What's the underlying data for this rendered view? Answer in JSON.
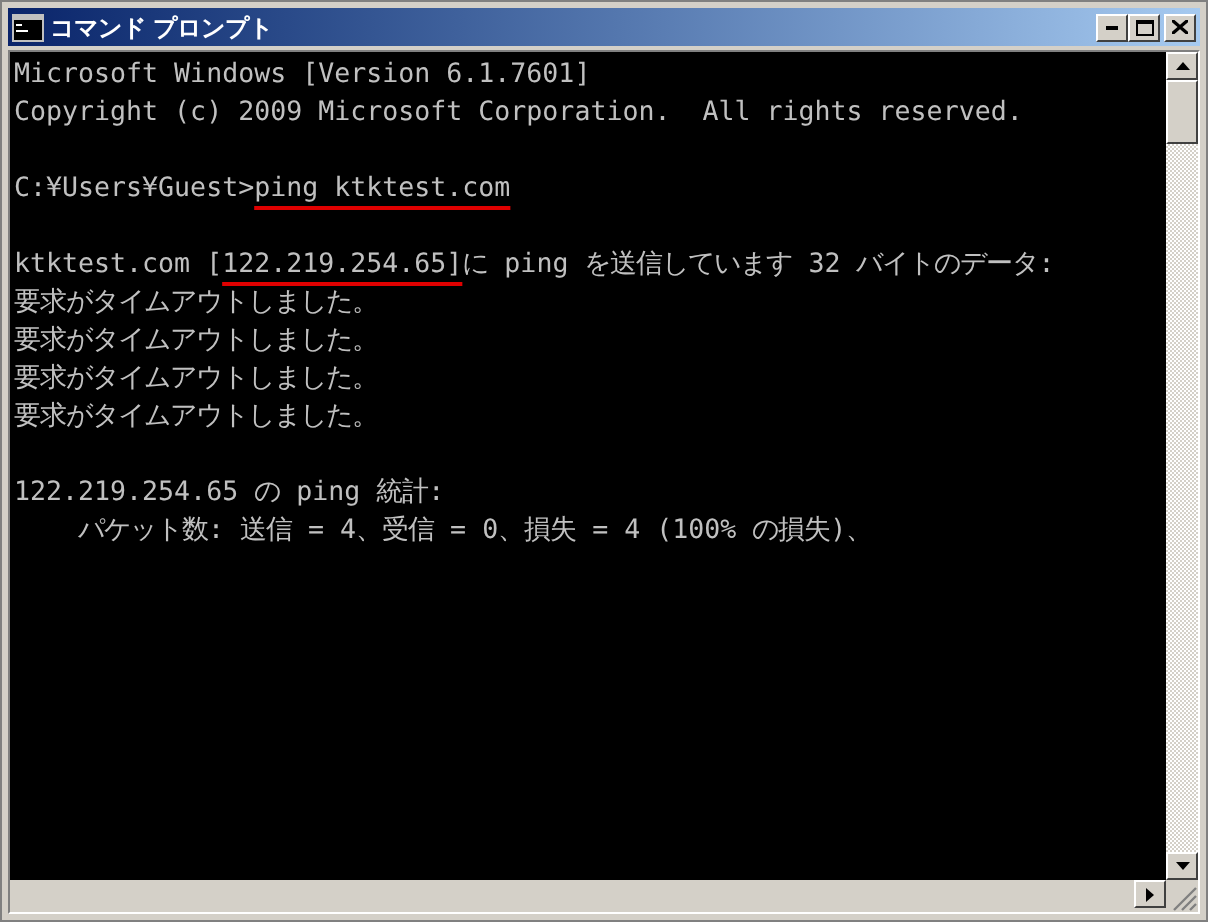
{
  "window": {
    "title": "コマンド プロンプト"
  },
  "console": {
    "lines": [
      {
        "kind": "text",
        "segments": [
          {
            "text": "Microsoft Windows [Version 6.1.7601]",
            "marked": false
          }
        ]
      },
      {
        "kind": "text",
        "segments": [
          {
            "text": "Copyright (c) 2009 Microsoft Corporation.  All rights reserved.",
            "marked": false
          }
        ]
      },
      {
        "kind": "blank"
      },
      {
        "kind": "text",
        "segments": [
          {
            "text": "C:¥Users¥Guest>",
            "marked": false
          },
          {
            "text": "ping ktktest.com",
            "marked": true
          }
        ]
      },
      {
        "kind": "blank"
      },
      {
        "kind": "text",
        "segments": [
          {
            "text": "ktktest.com [",
            "marked": false
          },
          {
            "text": "122.219.254.65]",
            "marked": true
          },
          {
            "text": "に ping を送信しています 32 バイトのデータ:",
            "marked": false
          }
        ]
      },
      {
        "kind": "text",
        "segments": [
          {
            "text": "要求がタイムアウトしました。",
            "marked": false
          }
        ]
      },
      {
        "kind": "text",
        "segments": [
          {
            "text": "要求がタイムアウトしました。",
            "marked": false
          }
        ]
      },
      {
        "kind": "text",
        "segments": [
          {
            "text": "要求がタイムアウトしました。",
            "marked": false
          }
        ]
      },
      {
        "kind": "text",
        "segments": [
          {
            "text": "要求がタイムアウトしました。",
            "marked": false
          }
        ]
      },
      {
        "kind": "blank"
      },
      {
        "kind": "text",
        "segments": [
          {
            "text": "122.219.254.65 の ping 統計:",
            "marked": false
          }
        ]
      },
      {
        "kind": "text",
        "segments": [
          {
            "text": "    パケット数: 送信 = 4、受信 = 0、損失 = 4 (100% の損失)、",
            "marked": false
          }
        ]
      }
    ]
  }
}
